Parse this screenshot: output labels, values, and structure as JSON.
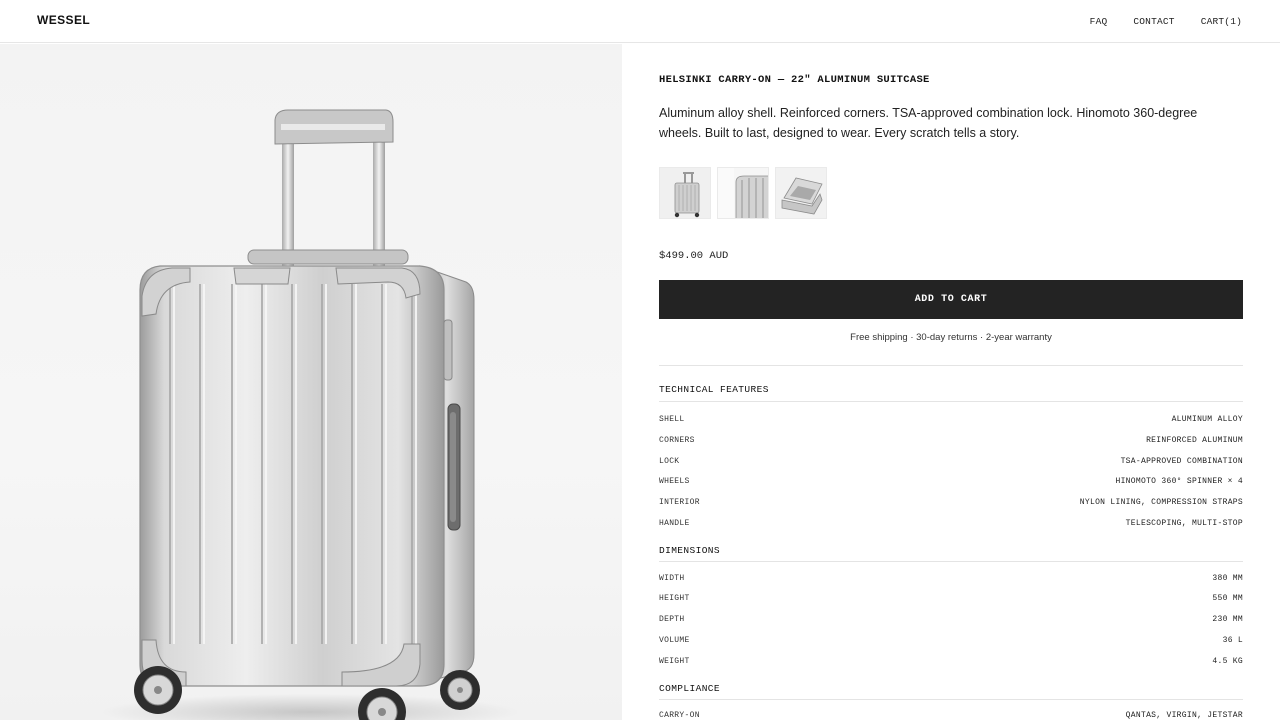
{
  "header": {
    "logo": "WESSEL",
    "nav": [
      "FAQ",
      "CONTACT",
      "CART(1)"
    ]
  },
  "product": {
    "title": "HELSINKI CARRY-ON — 22\" ALUMINUM SUITCASE",
    "description": "Aluminum alloy shell. Reinforced corners. TSA-approved combination lock. Hinomoto 360-degree wheels. Built to last, designed to wear. Every scratch tells a story.",
    "price": "$499.00 AUD",
    "add_to_cart": "ADD TO CART",
    "perks": "Free shipping · 30-day returns · 2-year warranty"
  },
  "sections": {
    "technical": {
      "heading": "TECHNICAL FEATURES",
      "rows": [
        {
          "k": "SHELL",
          "v": "ALUMINUM ALLOY"
        },
        {
          "k": "CORNERS",
          "v": "REINFORCED ALUMINUM"
        },
        {
          "k": "LOCK",
          "v": "TSA-APPROVED COMBINATION"
        },
        {
          "k": "WHEELS",
          "v": "HINOMOTO 360° SPINNER × 4"
        },
        {
          "k": "INTERIOR",
          "v": "NYLON LINING, COMPRESSION STRAPS"
        },
        {
          "k": "HANDLE",
          "v": "TELESCOPING, MULTI-STOP"
        }
      ]
    },
    "dimensions": {
      "heading": "DIMENSIONS",
      "rows": [
        {
          "k": "WIDTH",
          "v": "380 MM"
        },
        {
          "k": "HEIGHT",
          "v": "550 MM"
        },
        {
          "k": "DEPTH",
          "v": "230 MM"
        },
        {
          "k": "VOLUME",
          "v": "36 L"
        },
        {
          "k": "WEIGHT",
          "v": "4.5 KG"
        }
      ]
    },
    "compliance": {
      "heading": "COMPLIANCE",
      "rows": [
        {
          "k": "CARRY-ON",
          "v": "QANTAS, VIRGIN, JETSTAR"
        }
      ]
    }
  },
  "colors": {
    "button_bg": "#232323",
    "button_text": "#ffffff",
    "hero_bg": "#f3f3f3",
    "divider": "#e4e4e4"
  },
  "icons": {
    "main_image": "suitcase-icon",
    "thumbnails": [
      "suitcase-front-icon",
      "suitcase-side-icon",
      "suitcase-open-icon"
    ]
  }
}
